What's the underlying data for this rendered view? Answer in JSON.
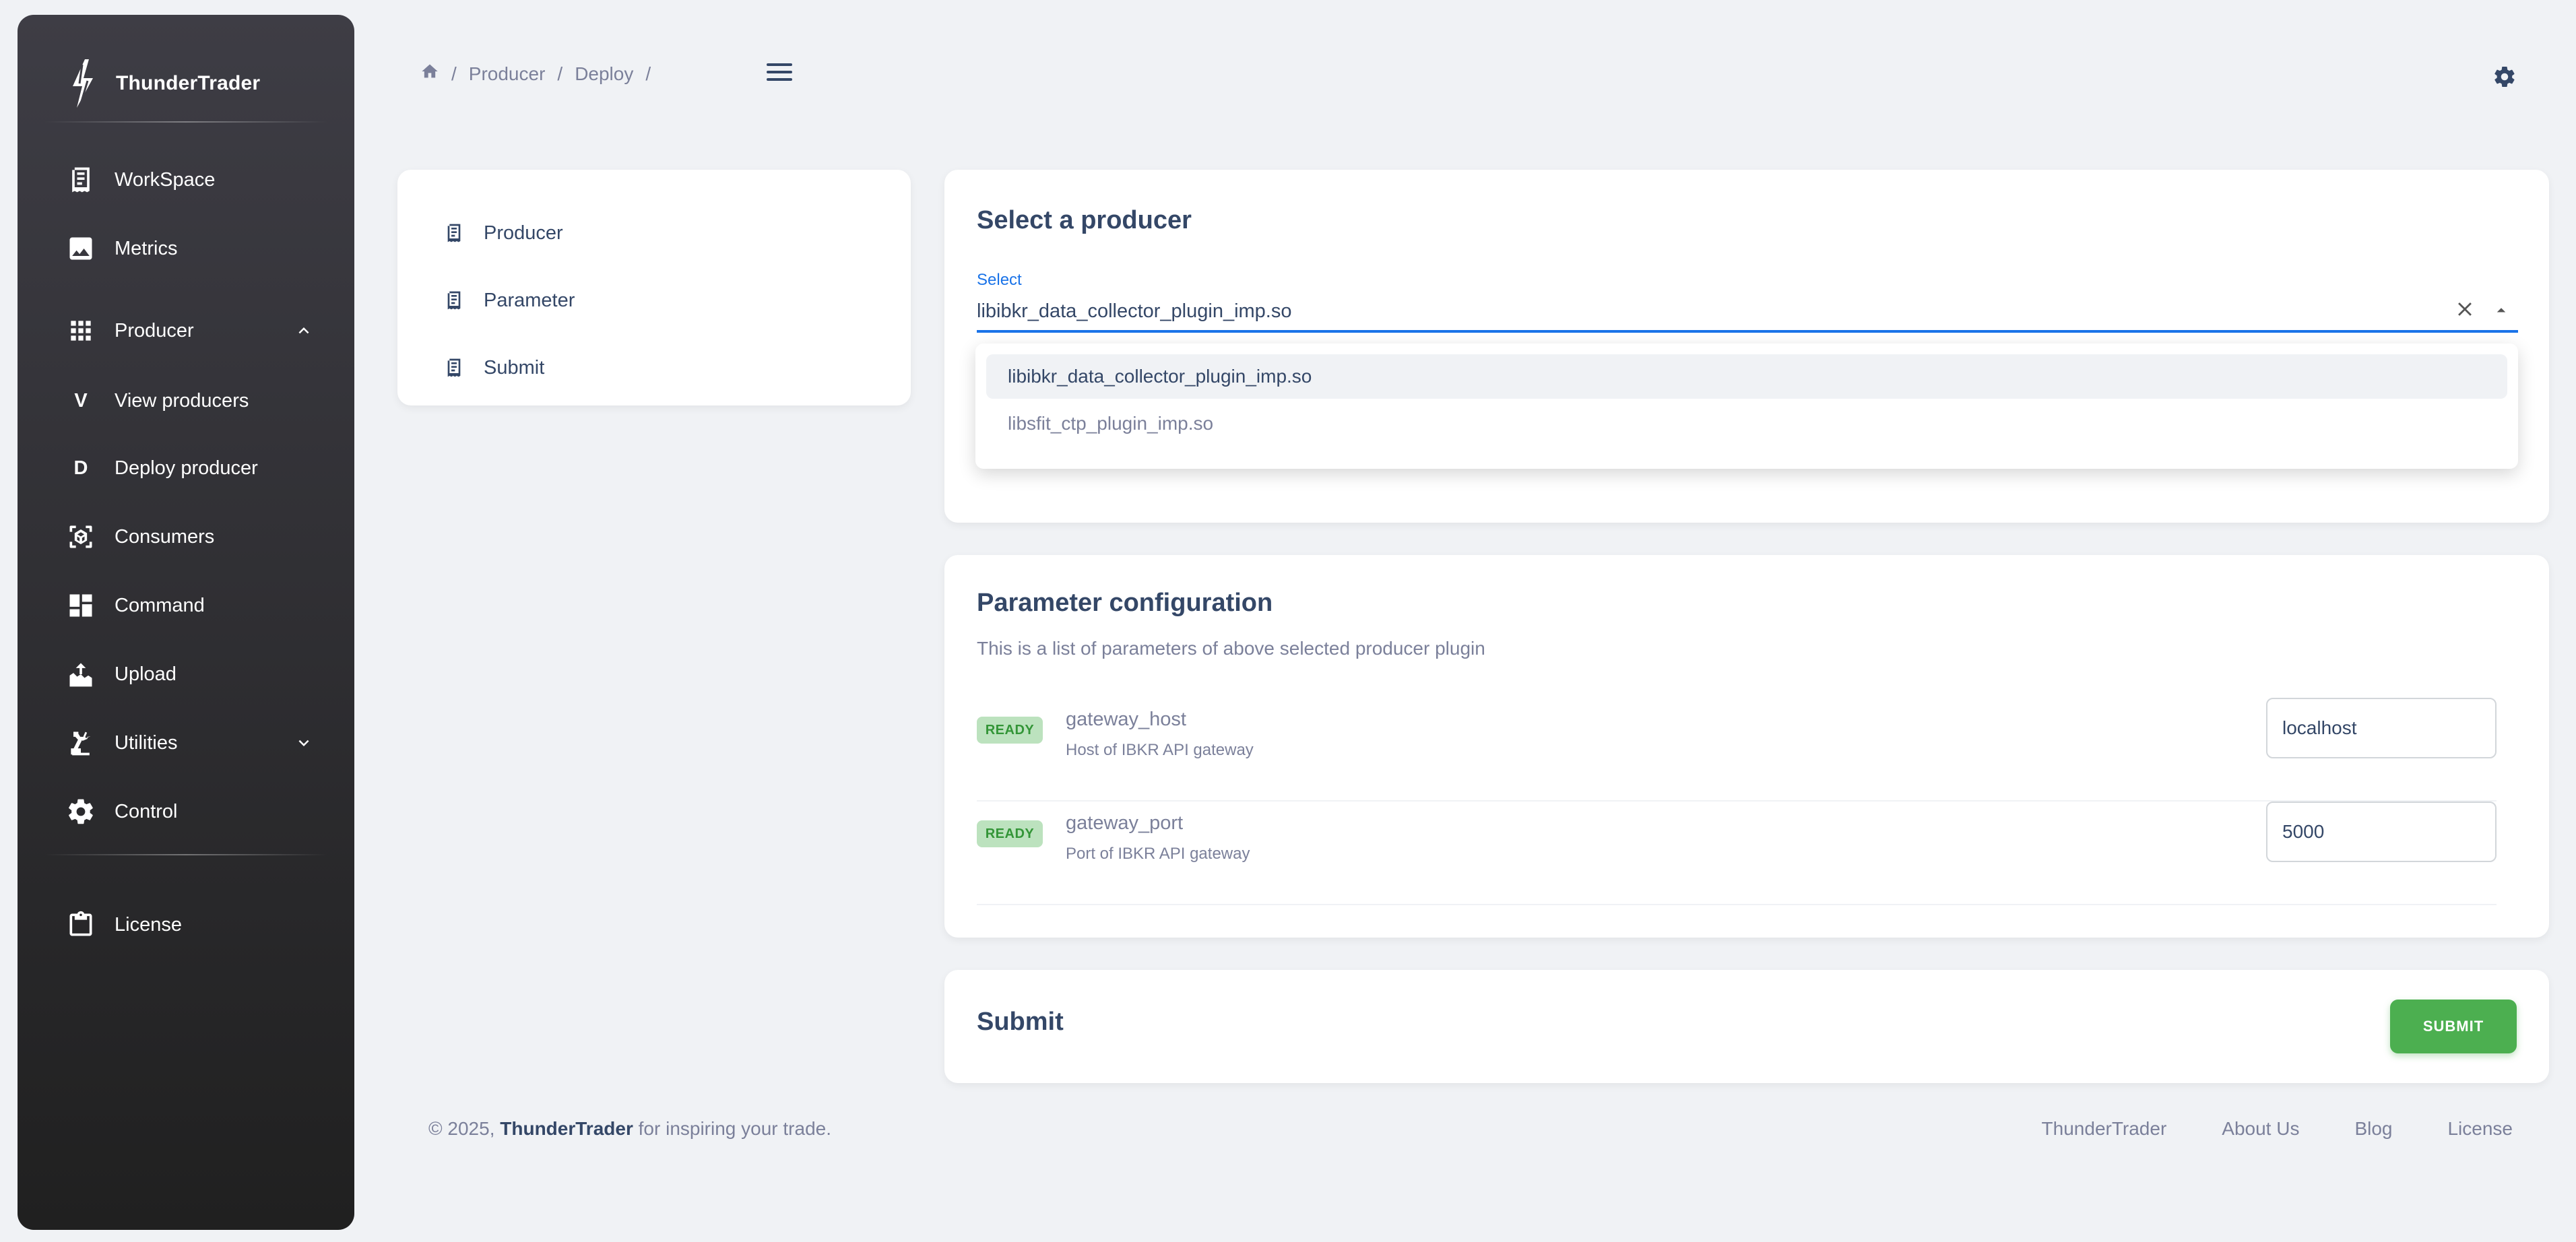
{
  "brand": {
    "name": "ThunderTrader",
    "icon": "bolt-logo-icon"
  },
  "sidebar": {
    "items": [
      {
        "label": "WorkSpace",
        "icon": "receipt-icon"
      },
      {
        "label": "Metrics",
        "icon": "image-icon"
      },
      {
        "label": "Producer",
        "icon": "apps-grid-icon",
        "expanded": true
      },
      {
        "label": "View producers",
        "letter": "V"
      },
      {
        "label": "Deploy producer",
        "letter": "D"
      },
      {
        "label": "Consumers",
        "icon": "view-in-ar-icon"
      },
      {
        "label": "Command",
        "icon": "dashboard-icon"
      },
      {
        "label": "Upload",
        "icon": "upload-tray-icon"
      },
      {
        "label": "Utilities",
        "icon": "precision-manufacturing-icon",
        "expanded": false
      },
      {
        "label": "Control",
        "icon": "settings-icon"
      },
      {
        "label": "License",
        "icon": "clipboard-icon"
      }
    ]
  },
  "header": {
    "breadcrumb": [
      "Producer",
      "Deploy"
    ],
    "separator": "/"
  },
  "steps": [
    "Producer",
    "Parameter",
    "Submit"
  ],
  "select_card": {
    "title": "Select a producer",
    "field_label": "Select",
    "value": "libibkr_data_collector_plugin_imp.so",
    "options": [
      "libibkr_data_collector_plugin_imp.so",
      "libsfit_ctp_plugin_imp.so"
    ]
  },
  "param_card": {
    "title": "Parameter configuration",
    "subtitle": "This is a list of parameters of above selected producer plugin",
    "params": [
      {
        "status": "READY",
        "name": "gateway_host",
        "desc": "Host of IBKR API gateway",
        "value": "localhost"
      },
      {
        "status": "READY",
        "name": "gateway_port",
        "desc": "Port of IBKR API gateway",
        "value": "5000"
      }
    ]
  },
  "submit_card": {
    "title": "Submit",
    "button": "SUBMIT"
  },
  "footer": {
    "prefix": "© 2025,",
    "brand": "ThunderTrader",
    "suffix": "for inspiring your trade.",
    "links": [
      "ThunderTrader",
      "About Us",
      "Blog",
      "License"
    ]
  },
  "colors": {
    "accent": "#1a73e8",
    "success": "#4caf50",
    "text": "#344767",
    "muted": "#7b809a"
  }
}
